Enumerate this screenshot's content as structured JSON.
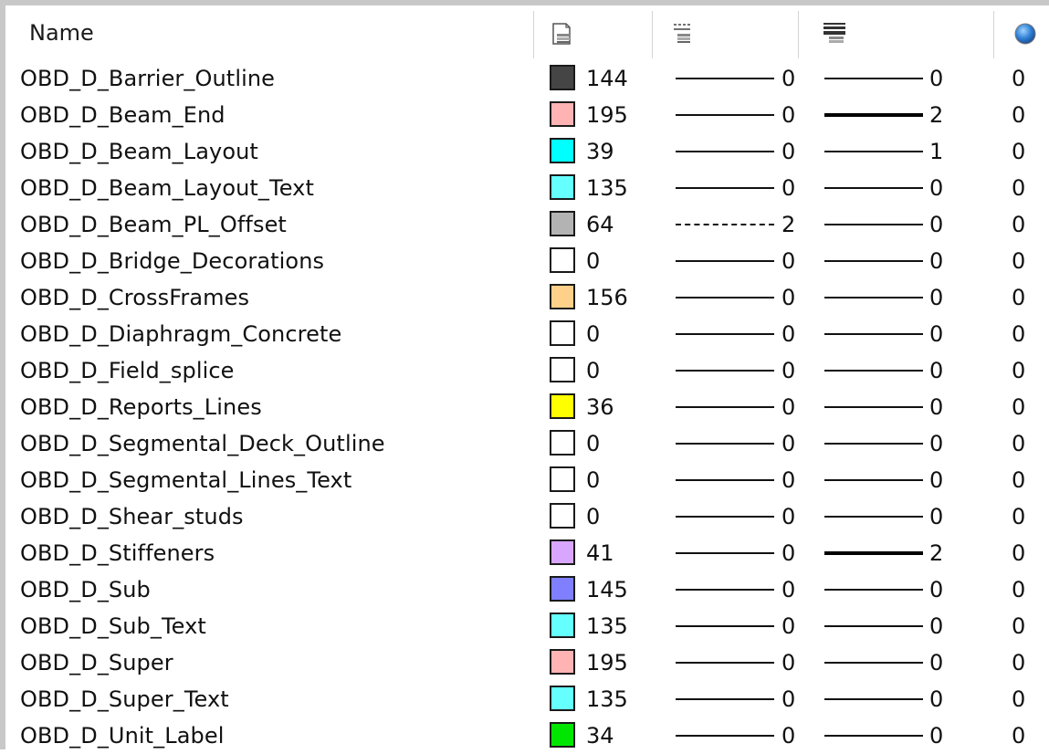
{
  "header": {
    "name_label": "Name",
    "color_icon": "level-color-icon",
    "style_icon": "line-style-icon",
    "weight_icon": "line-weight-icon",
    "transparency_icon": "transparency-globe-icon"
  },
  "rows": [
    {
      "name": "OBD_D_Barrier_Outline",
      "color": "#454545",
      "color_num": "144",
      "style": "solid",
      "style_num": "0",
      "weight": "thin",
      "weight_num": "0",
      "trans": "0"
    },
    {
      "name": "OBD_D_Beam_End",
      "color": "#ffb3b3",
      "color_num": "195",
      "style": "solid",
      "style_num": "0",
      "weight": "thick",
      "weight_num": "2",
      "trans": "0"
    },
    {
      "name": "OBD_D_Beam_Layout",
      "color": "#00ffff",
      "color_num": "39",
      "style": "solid",
      "style_num": "0",
      "weight": "thin",
      "weight_num": "1",
      "trans": "0"
    },
    {
      "name": "OBD_D_Beam_Layout_Text",
      "color": "#66ffff",
      "color_num": "135",
      "style": "solid",
      "style_num": "0",
      "weight": "thin",
      "weight_num": "0",
      "trans": "0"
    },
    {
      "name": "OBD_D_Beam_PL_Offset",
      "color": "#b3b3b3",
      "color_num": "64",
      "style": "dashed",
      "style_num": "2",
      "weight": "thin",
      "weight_num": "0",
      "trans": "0"
    },
    {
      "name": "OBD_D_Bridge_Decorations",
      "color": "#ffffff",
      "color_num": "0",
      "style": "solid",
      "style_num": "0",
      "weight": "thin",
      "weight_num": "0",
      "trans": "0"
    },
    {
      "name": "OBD_D_CrossFrames",
      "color": "#ffd08a",
      "color_num": "156",
      "style": "solid",
      "style_num": "0",
      "weight": "thin",
      "weight_num": "0",
      "trans": "0"
    },
    {
      "name": "OBD_D_Diaphragm_Concrete",
      "color": "#ffffff",
      "color_num": "0",
      "style": "solid",
      "style_num": "0",
      "weight": "thin",
      "weight_num": "0",
      "trans": "0"
    },
    {
      "name": "OBD_D_Field_splice",
      "color": "#ffffff",
      "color_num": "0",
      "style": "solid",
      "style_num": "0",
      "weight": "thin",
      "weight_num": "0",
      "trans": "0"
    },
    {
      "name": "OBD_D_Reports_Lines",
      "color": "#ffff00",
      "color_num": "36",
      "style": "solid",
      "style_num": "0",
      "weight": "thin",
      "weight_num": "0",
      "trans": "0"
    },
    {
      "name": "OBD_D_Segmental_Deck_Outline",
      "color": "#ffffff",
      "color_num": "0",
      "style": "solid",
      "style_num": "0",
      "weight": "thin",
      "weight_num": "0",
      "trans": "0"
    },
    {
      "name": "OBD_D_Segmental_Lines_Text",
      "color": "#ffffff",
      "color_num": "0",
      "style": "solid",
      "style_num": "0",
      "weight": "thin",
      "weight_num": "0",
      "trans": "0"
    },
    {
      "name": "OBD_D_Shear_studs",
      "color": "#ffffff",
      "color_num": "0",
      "style": "solid",
      "style_num": "0",
      "weight": "thin",
      "weight_num": "0",
      "trans": "0"
    },
    {
      "name": "OBD_D_Stiffeners",
      "color": "#d9a6ff",
      "color_num": "41",
      "style": "solid",
      "style_num": "0",
      "weight": "thick",
      "weight_num": "2",
      "trans": "0"
    },
    {
      "name": "OBD_D_Sub",
      "color": "#7f7fff",
      "color_num": "145",
      "style": "solid",
      "style_num": "0",
      "weight": "thin",
      "weight_num": "0",
      "trans": "0"
    },
    {
      "name": "OBD_D_Sub_Text",
      "color": "#66ffff",
      "color_num": "135",
      "style": "solid",
      "style_num": "0",
      "weight": "thin",
      "weight_num": "0",
      "trans": "0"
    },
    {
      "name": "OBD_D_Super",
      "color": "#ffb3b3",
      "color_num": "195",
      "style": "solid",
      "style_num": "0",
      "weight": "thin",
      "weight_num": "0",
      "trans": "0"
    },
    {
      "name": "OBD_D_Super_Text",
      "color": "#66ffff",
      "color_num": "135",
      "style": "solid",
      "style_num": "0",
      "weight": "thin",
      "weight_num": "0",
      "trans": "0"
    },
    {
      "name": "OBD_D_Unit_Label",
      "color": "#00e600",
      "color_num": "34",
      "style": "solid",
      "style_num": "0",
      "weight": "thin",
      "weight_num": "0",
      "trans": "0"
    }
  ]
}
